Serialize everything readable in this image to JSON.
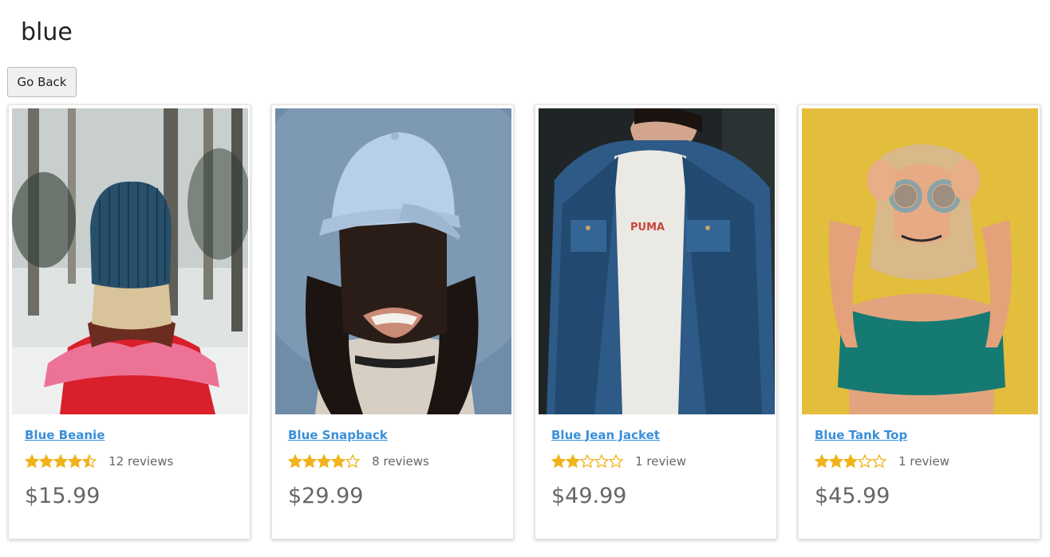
{
  "page": {
    "title": "blue",
    "back_label": "Go Back"
  },
  "colors": {
    "link": "#3a8fd9",
    "star": "#f0b31b",
    "price": "#666666"
  },
  "products": [
    {
      "name": "Blue Beanie",
      "rating": 4.5,
      "reviews": "12 reviews",
      "price": "$15.99",
      "image": "woman-in-blue-beanie-snow-photo"
    },
    {
      "name": "Blue Snapback",
      "rating": 4,
      "reviews": "8 reviews",
      "price": "$29.99",
      "image": "woman-in-light-blue-cap-photo"
    },
    {
      "name": "Blue Jean Jacket",
      "rating": 2,
      "reviews": "1 review",
      "price": "$49.99",
      "image": "man-in-denim-jacket-photo"
    },
    {
      "name": "Blue Tank Top",
      "rating": 3,
      "reviews": "1 review",
      "price": "$45.99",
      "image": "woman-in-teal-tank-top-photo"
    }
  ]
}
